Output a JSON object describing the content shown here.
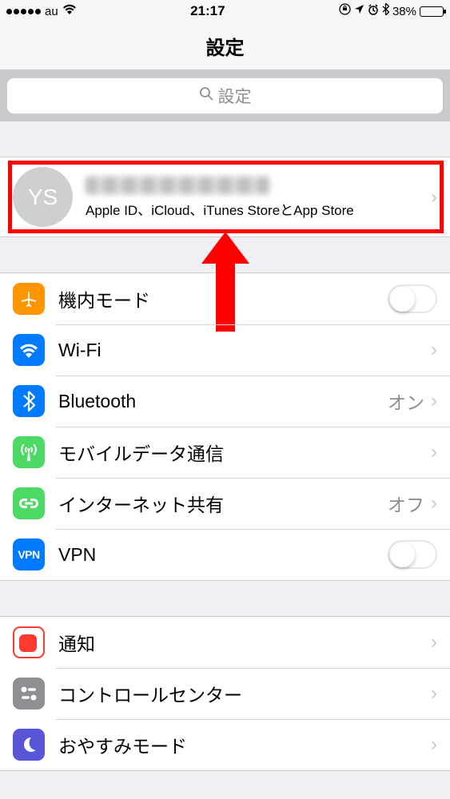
{
  "status": {
    "carrier": "au",
    "time": "21:17",
    "battery_pct": "38%"
  },
  "nav": {
    "title": "設定"
  },
  "search": {
    "placeholder": "設定"
  },
  "profile": {
    "initials": "YS",
    "subtitle": "Apple ID、iCloud、iTunes StoreとApp Store"
  },
  "rows": {
    "airplane": "機内モード",
    "wifi": "Wi-Fi",
    "bt": "Bluetooth",
    "bt_value": "オン",
    "cell": "モバイルデータ通信",
    "hotspot": "インターネット共有",
    "hotspot_value": "オフ",
    "vpn": "VPN",
    "notif": "通知",
    "cc": "コントロールセンター",
    "dnd": "おやすみモード"
  },
  "vpn_badge": "VPN"
}
